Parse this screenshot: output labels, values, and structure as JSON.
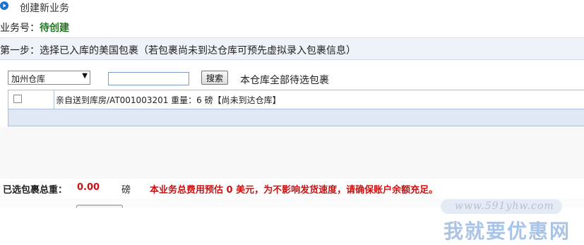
{
  "header": {
    "title": "创建新业务",
    "icon": "play-circle-icon"
  },
  "business": {
    "label": "业务号：",
    "value": "待创建"
  },
  "step": {
    "text": "第一步：选择已入库的美国包裹（若包裹尚未到达仓库可预先虚拟录入包裹信息）"
  },
  "filter": {
    "warehouse_selected": "加州仓库",
    "search_value": "",
    "search_button": "搜索",
    "pending_title": "本仓库全部待选包裹"
  },
  "packages": [
    {
      "checked": false,
      "description": "亲自送到库房/AT001003201 重量：6 磅【尚未到达仓库】"
    }
  ],
  "summary": {
    "total_label": "已选包裹总重：",
    "total_value": "0.00",
    "total_unit": "磅",
    "fee_notice": "本业务总费用预估 0 美元，为不影响发货速度，请确保账户余额充足。"
  },
  "watermark": {
    "url": "www.591yhw.com",
    "name": "我就要优惠网"
  },
  "colors": {
    "accent_blue": "#1a6fd0",
    "highlight_red": "#cc1111",
    "status_green": "#1f7a1f",
    "step_bar_bg": "#eef3fa"
  }
}
